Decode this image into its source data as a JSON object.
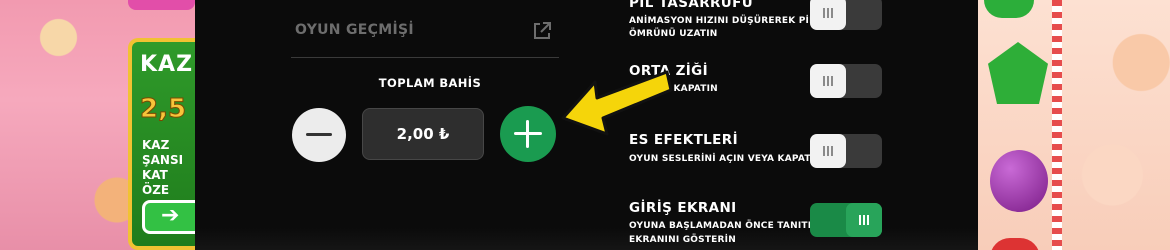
{
  "game": {
    "promo": {
      "title": "KAZ",
      "amount": "2,5",
      "lines": [
        "KAZ",
        "ŞANSI",
        "KAT",
        "ÖZE"
      ],
      "button_icon": "arrow-right-icon"
    }
  },
  "menu": {
    "history_label": "OYUN GEÇMİŞİ",
    "history_icon": "external-link-icon"
  },
  "bet": {
    "label": "TOPLAM BAHİS",
    "value": "2,00 ₺",
    "decrease_icon": "minus-icon",
    "increase_icon": "plus-icon"
  },
  "settings": [
    {
      "title": "PİL TASARRUFU",
      "desc": "ANİMASYON HIZINI DÜŞÜREREK PİL",
      "desc2": "ÖMRÜNÜ UZATIN",
      "enabled": false
    },
    {
      "title": "ORTA      ZİĞİ",
      "desc": "       IN VEYA KAPATIN",
      "desc2": "",
      "enabled": false
    },
    {
      "title": "  ES EFEKTLERİ",
      "desc": "OYUN SESLERİNİ AÇIN VEYA KAPATIN",
      "desc2": "",
      "enabled": false
    },
    {
      "title": "GİRİŞ EKRANI",
      "desc": "OYUNA BAŞLAMADAN ÖNCE TANITIM",
      "desc2": "EKRANINI GÖSTERİN",
      "enabled": true
    }
  ],
  "colors": {
    "panel": "#0b0b0b",
    "accent_green": "#1a9b50",
    "arrow_yellow": "#f5d50a"
  }
}
